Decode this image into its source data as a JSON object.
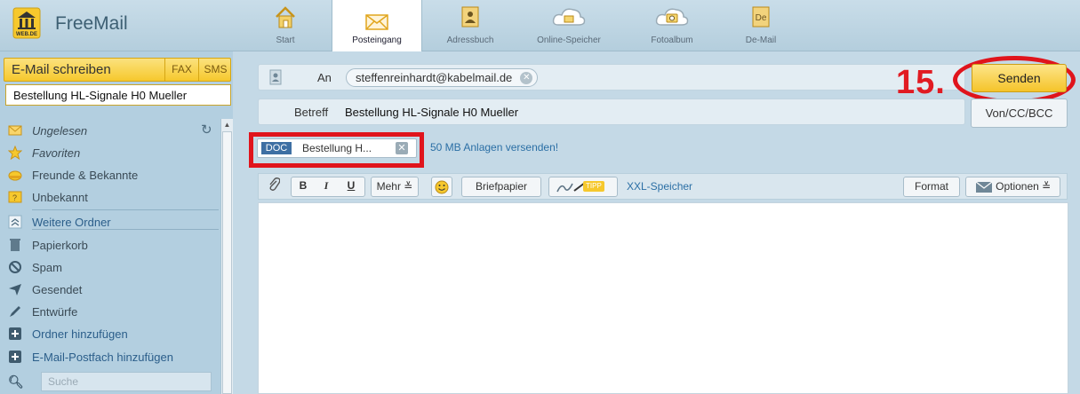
{
  "brand": {
    "logo_text": "WEB.DE",
    "name": "FreeMail"
  },
  "nav": [
    {
      "label": "Start",
      "icon": "home-icon"
    },
    {
      "label": "Posteingang",
      "icon": "envelope-icon",
      "active": true
    },
    {
      "label": "Adressbuch",
      "icon": "addressbook-icon"
    },
    {
      "label": "Online-Speicher",
      "icon": "cloud-icon"
    },
    {
      "label": "Fotoalbum",
      "icon": "camera-cloud-icon"
    },
    {
      "label": "De-Mail",
      "icon": "demail-icon"
    }
  ],
  "sidebar": {
    "compose_label": "E-Mail schreiben",
    "fax_label": "FAX",
    "sms_label": "SMS",
    "draft_title": "Bestellung HL-Signale H0 Mueller",
    "folders": [
      {
        "label": "Ungelesen",
        "icon": "envelope-icon",
        "italic": true
      },
      {
        "label": "Favoriten",
        "icon": "star-icon",
        "italic": true
      },
      {
        "label": "Freunde & Bekannte",
        "icon": "friends-icon"
      },
      {
        "label": "Unbekannt",
        "icon": "unknown-icon"
      },
      {
        "label": "Weitere Ordner",
        "icon": "chevron-up-icon",
        "link": true
      },
      {
        "label": "Papierkorb",
        "icon": "trash-icon"
      },
      {
        "label": "Spam",
        "icon": "spam-icon"
      },
      {
        "label": "Gesendet",
        "icon": "sent-icon"
      },
      {
        "label": "Entwürfe",
        "icon": "pencil-icon"
      },
      {
        "label": "Ordner hinzufügen",
        "icon": "plus-icon",
        "link": true
      },
      {
        "label": "E-Mail-Postfach hinzufügen",
        "icon": "plus-icon",
        "link": true
      }
    ],
    "search_placeholder": "Suche"
  },
  "compose": {
    "to_label": "An",
    "recipient": "steffenreinhardt@kabelmail.de",
    "subject_label": "Betreff",
    "subject": "Bestellung HL-Signale H0 Mueller",
    "send_label": "Senden",
    "cc_label": "Von/CC/BCC",
    "step_number": "15.",
    "attachment": {
      "type": "DOC",
      "name": "Bestellung H..."
    },
    "attach_link": "50 MB Anlagen versenden!"
  },
  "toolbar": {
    "bold": "B",
    "italic": "I",
    "underline": "U",
    "more": "Mehr ≚",
    "letterpaper": "Briefpapier",
    "tipp": "TIPP",
    "xxl": "XXL-Speicher",
    "format": "Format",
    "options": "Optionen ≚"
  },
  "colors": {
    "accent_red": "#e0141c",
    "send_yellow": "#f5c42a",
    "link_blue": "#2b6fa5"
  }
}
